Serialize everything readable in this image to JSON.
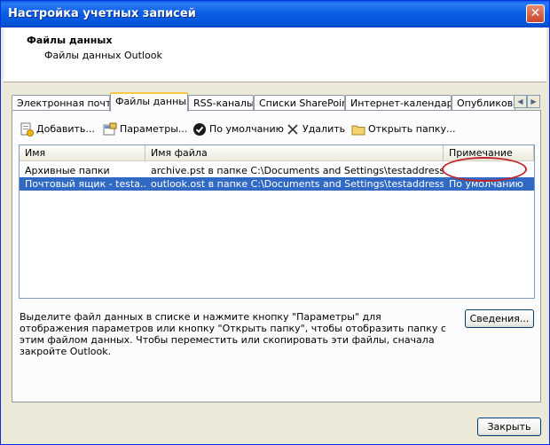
{
  "window": {
    "title": "Настройка учетных записей",
    "close_label": "✕"
  },
  "header": {
    "title": "Файлы данных",
    "subtitle": "Файлы данных Outlook"
  },
  "tabs": [
    {
      "label": "Электронная почта"
    },
    {
      "label": "Файлы данных"
    },
    {
      "label": "RSS-каналы"
    },
    {
      "label": "Списки SharePoint"
    },
    {
      "label": "Интернет-календари"
    },
    {
      "label": "Опубликова"
    }
  ],
  "toolbar": {
    "add_label": "Добавить...",
    "params_label": "Параметры...",
    "default_label": "По умолчанию",
    "delete_label": "Удалить",
    "open_folder_label": "Открыть папку..."
  },
  "list": {
    "columns": [
      "Имя",
      "Имя файла",
      "Примечание"
    ],
    "rows": [
      {
        "name": "Архивные папки",
        "file": "archive.pst в папке C:\\Documents and Settings\\testaddressboo...",
        "note": ""
      },
      {
        "name": "Почтовый ящик - testa...",
        "file": "outlook.ost в папке C:\\Documents and Settings\\testaddressboo...",
        "note": "По умолчанию"
      }
    ]
  },
  "description": "Выделите файл данных в списке и нажмите кнопку \"Параметры\" для отображения параметров или кнопку \"Открыть папку\", чтобы отобразить папку с этим файлом данных. Чтобы переместить или скопировать эти файлы, сначала закройте Outlook.",
  "buttons": {
    "details_label": "Сведения...",
    "close_label": "Закрыть"
  }
}
